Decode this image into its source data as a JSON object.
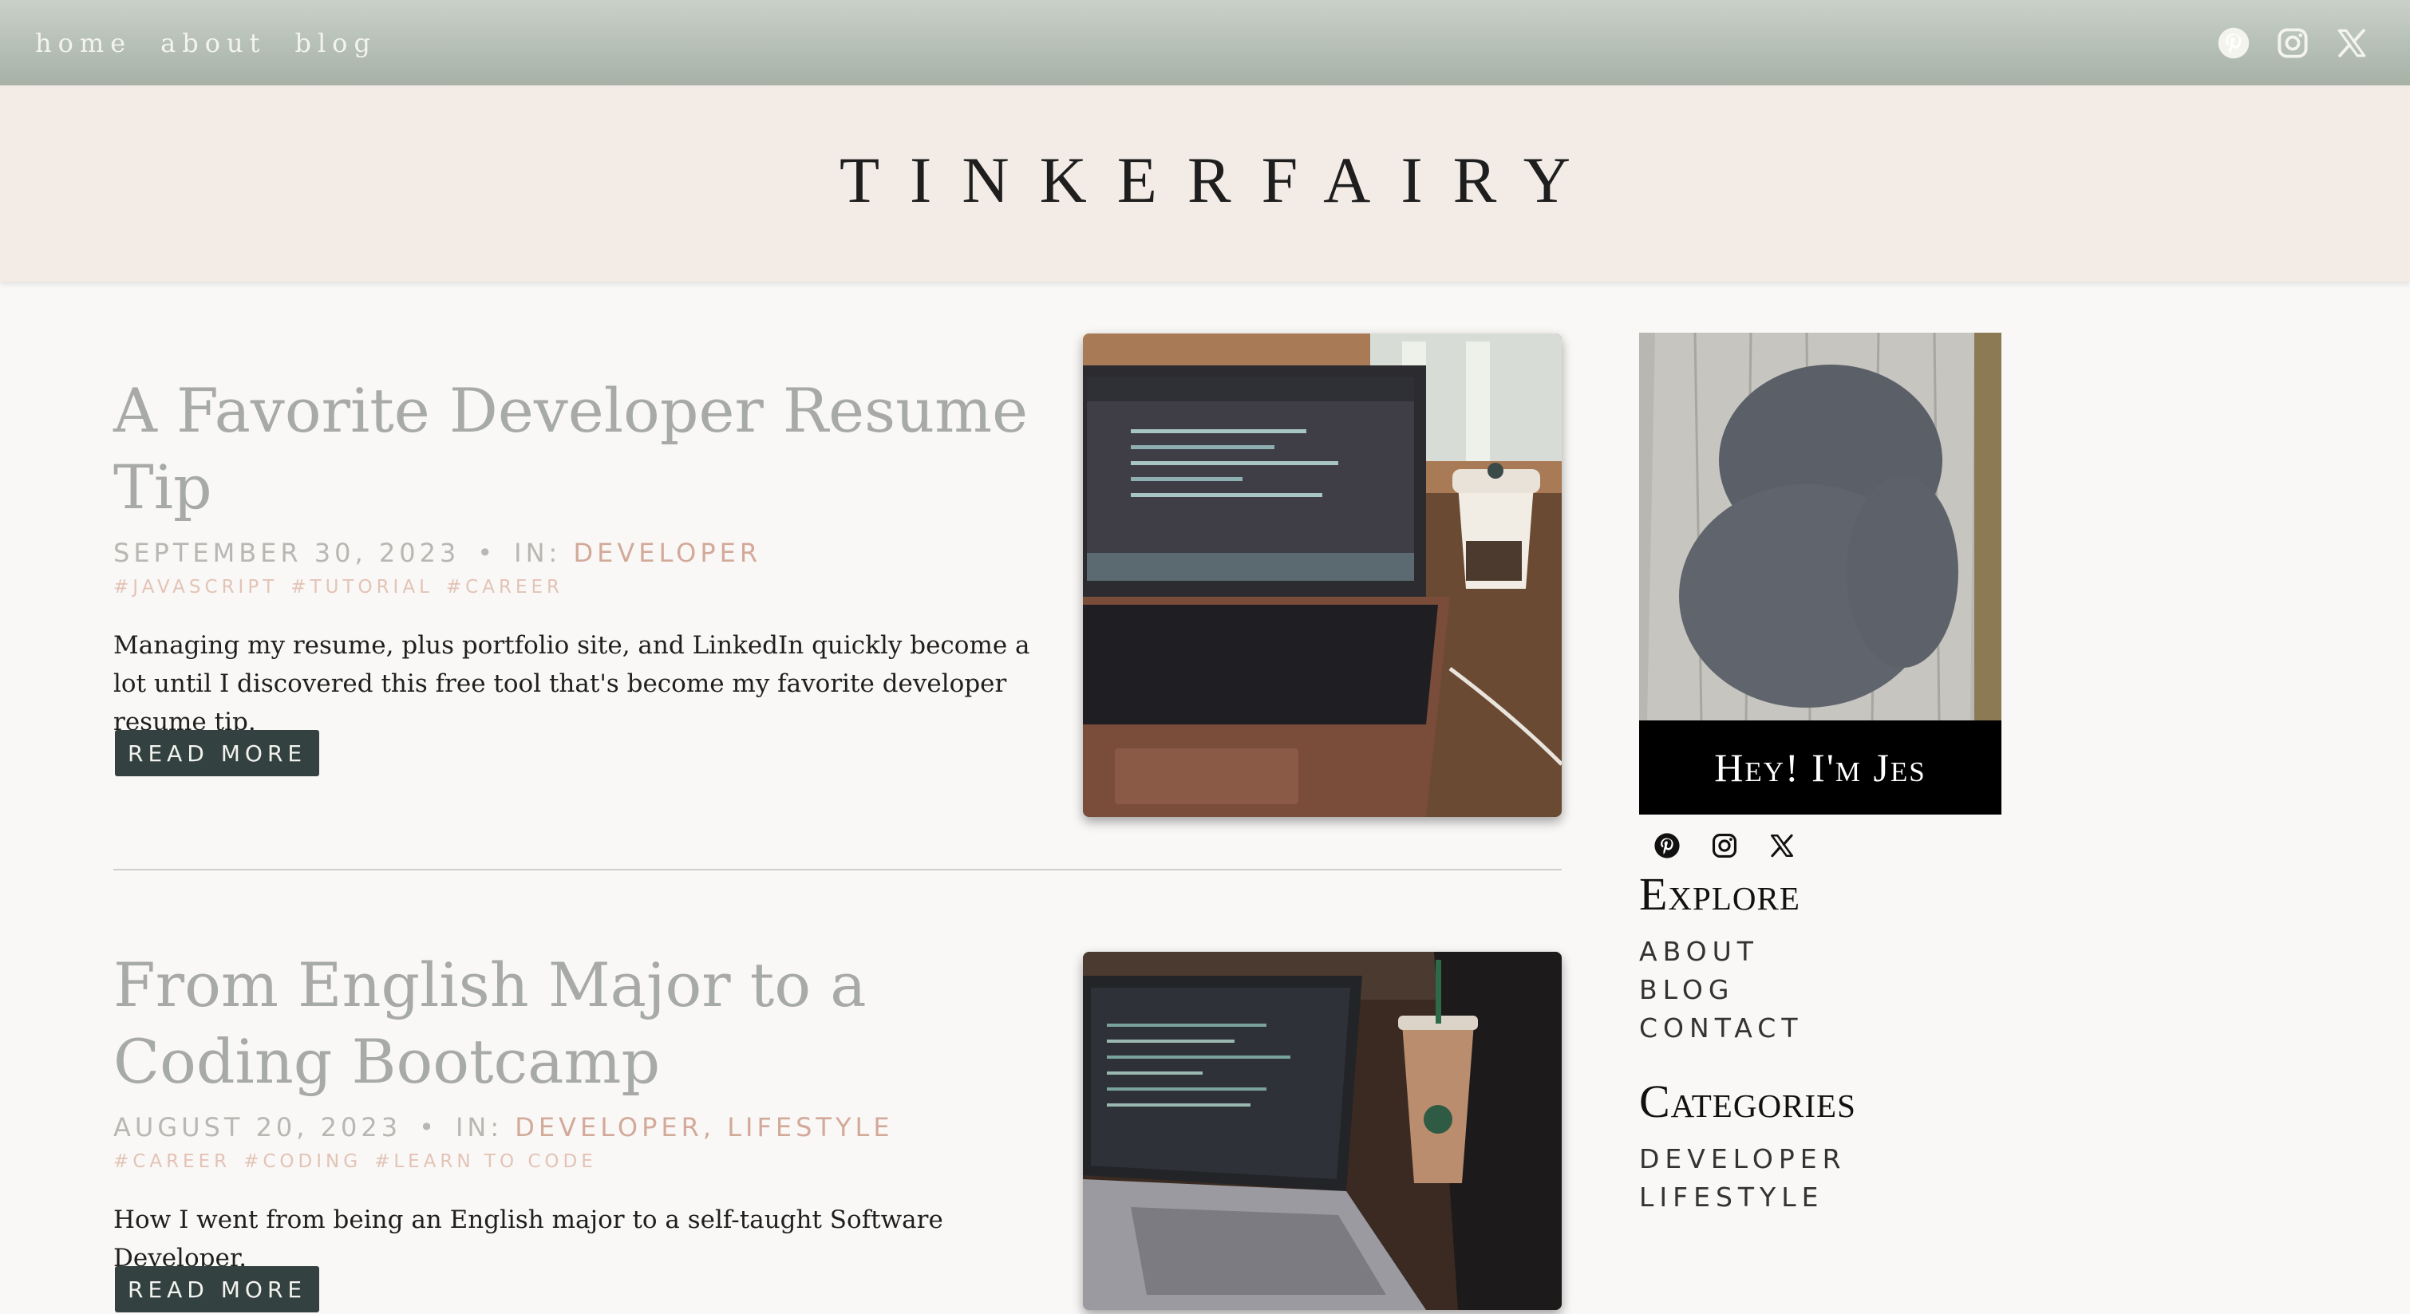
{
  "nav": {
    "links": [
      "home",
      "about",
      "blog"
    ],
    "social": [
      "pinterest-icon",
      "instagram-icon",
      "x-icon"
    ]
  },
  "site": {
    "title": "TINKERFAIRY"
  },
  "posts": [
    {
      "title": "A Favorite Developer Resume Tip",
      "date": "SEPTEMBER 30, 2023",
      "in_label": "IN:",
      "categories": "DEVELOPER",
      "tags": [
        "#JAVASCRIPT",
        "#TUTORIAL",
        "#CAREER"
      ],
      "excerpt": "Managing my resume, plus portfolio site, and LinkedIn quickly become a lot until I discovered this free tool that's become my favorite developer resume tip.",
      "button": "READ MORE"
    },
    {
      "title": "From English Major to a Coding Bootcamp",
      "date": "AUGUST 20, 2023",
      "in_label": "IN:",
      "categories": "DEVELOPER, LIFESTYLE",
      "tags": [
        "#CAREER",
        "#CODING",
        "#LEARN TO CODE"
      ],
      "excerpt": "How I went from being an English major to a self-taught Software Developer.",
      "button": "READ MORE"
    }
  ],
  "sidebar": {
    "profile_caption": "Hey! I'm Jes",
    "explore_heading": "Explore",
    "explore_links": [
      "ABOUT",
      "BLOG",
      "CONTACT"
    ],
    "categories_heading": "Categories",
    "category_links": [
      "DEVELOPER",
      "LIFESTYLE"
    ]
  },
  "colors": {
    "nav_gradient_top": "#c9d1c8",
    "banner": "#f2ebe6",
    "button": "#334240",
    "category_accent": "#d3a999",
    "tag_accent": "#e3c3b6"
  }
}
